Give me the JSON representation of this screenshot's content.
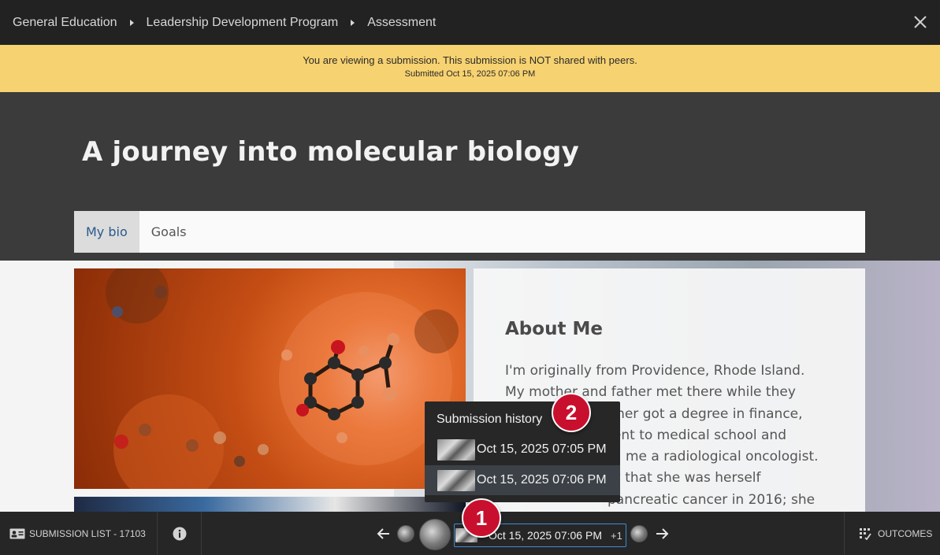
{
  "breadcrumb": {
    "items": [
      "General Education",
      "Leadership Development Program",
      "Assessment"
    ]
  },
  "close": {
    "icon": "close-icon"
  },
  "banner": {
    "line1": "You are viewing a submission. This submission is NOT shared with peers.",
    "line2": "Submitted Oct 15, 2025 07:06 PM"
  },
  "page": {
    "title": "A journey into molecular biology",
    "tabs": [
      {
        "label": "My bio",
        "active": true
      },
      {
        "label": "Goals",
        "active": false
      }
    ]
  },
  "about": {
    "title": "About Me",
    "lines": [
      "I'm originally from Providence, Rhode Island.",
      "My mother and father met there while they",
      "father got a degree in finance,",
      "went to medical school and",
      "me a radiological oncologist.",
      "ny that she was herself",
      "pancreatic cancer in 2016; she"
    ]
  },
  "history": {
    "title": "Submission history",
    "items": [
      {
        "label": "Oct 15, 2025 07:05 PM",
        "selected": false
      },
      {
        "label": "Oct 15, 2025 07:06 PM",
        "selected": true
      }
    ]
  },
  "callouts": [
    "1",
    "2"
  ],
  "bottombar": {
    "submission_list": "SUBMISSION LIST - 17103",
    "current_submission": "Oct 15, 2025 07:06 PM",
    "extra_count": "+1",
    "outcomes": "OUTCOMES"
  },
  "colors": {
    "banner": "#f7d270",
    "callout": "#c8102e",
    "active_tab_text": "#2a5a8c",
    "current_outline": "#3e8dd6"
  }
}
